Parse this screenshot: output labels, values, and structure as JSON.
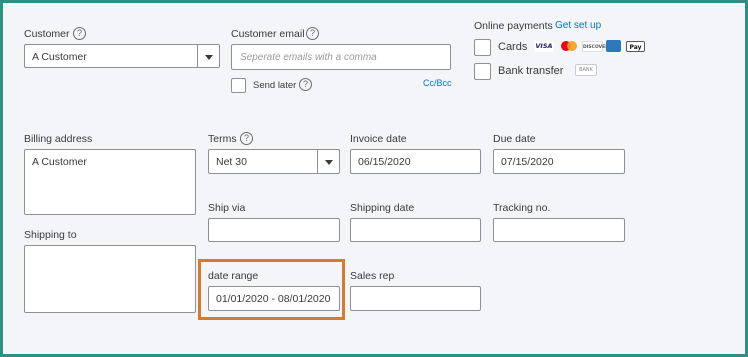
{
  "customer": {
    "label": "Customer",
    "help": "?",
    "value": "A  Customer"
  },
  "customer_email": {
    "label": "Customer email",
    "help": "?",
    "placeholder": "Seperate emails with a comma",
    "send_later_label": "Send later",
    "help2": "?",
    "ccbcc_link": "Cc/Bcc"
  },
  "online_payments": {
    "label": "Online payments",
    "setup_link": "Get set up",
    "cards_label": "Cards",
    "bank_label": "Bank transfer",
    "badges": {
      "visa": "VISA",
      "discover": "DISCOVER",
      "applepay": "Pay",
      "bank": "BANK"
    },
    "colors": {
      "visa": "#1a1f71",
      "mastercard_red": "#eb001b",
      "mastercard_orange": "#f79e1b",
      "amex": "#2e77bb"
    }
  },
  "billing": {
    "label": "Billing address",
    "value": "A Customer"
  },
  "shipping_to": {
    "label": "Shipping to"
  },
  "terms": {
    "label": "Terms",
    "help": "?",
    "value": "Net 30"
  },
  "invoice_date": {
    "label": "Invoice date",
    "value": "06/15/2020"
  },
  "due_date": {
    "label": "Due date",
    "value": "07/15/2020"
  },
  "ship_via": {
    "label": "Ship via"
  },
  "shipping_date": {
    "label": "Shipping date"
  },
  "tracking": {
    "label": "Tracking no."
  },
  "date_range": {
    "label": "date range",
    "value": "01/01/2020 - 08/01/2020",
    "highlight_color": "#d97a2b"
  },
  "sales_rep": {
    "label": "Sales rep"
  }
}
